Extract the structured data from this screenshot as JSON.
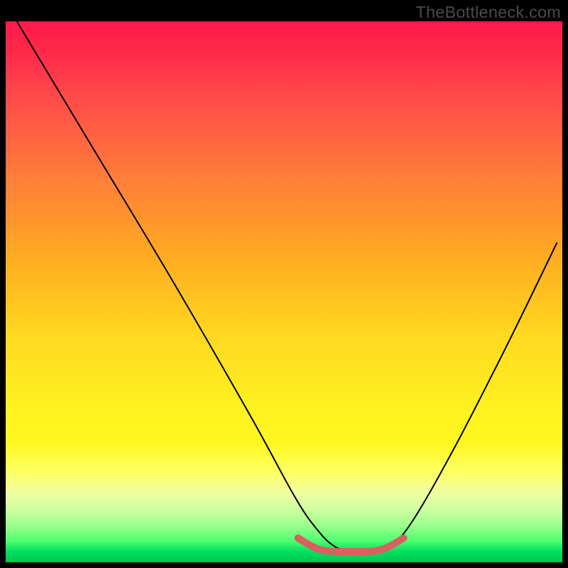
{
  "watermark": "TheBottleneck.com",
  "chart_data": {
    "type": "line",
    "title": "",
    "xlabel": "",
    "ylabel": "",
    "xlim": [
      0,
      100
    ],
    "ylim": [
      0,
      100
    ],
    "series": [
      {
        "name": "curve",
        "x": [
          2,
          16,
          30,
          44,
          52,
          56,
          59,
          62,
          65,
          68,
          72,
          80,
          90,
          99
        ],
        "values": [
          100,
          76,
          52,
          27,
          12,
          6,
          3,
          2,
          2,
          3,
          6,
          20,
          40,
          59
        ]
      }
    ],
    "highlight": {
      "name": "flat-region",
      "x": [
        52.5,
        56,
        59,
        62,
        65,
        68,
        71.5
      ],
      "values": [
        4.5,
        2.5,
        2,
        2,
        2,
        2.5,
        4.5
      ]
    },
    "colors": {
      "curve": "#000000",
      "highlight": "#d86060"
    }
  }
}
